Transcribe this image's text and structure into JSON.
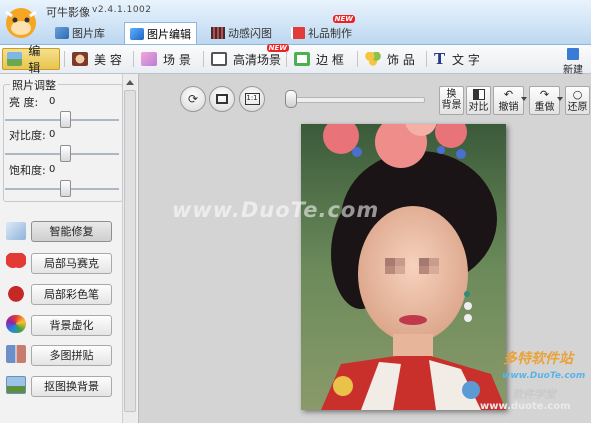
{
  "app": {
    "title": "可牛影像",
    "version": "v2.4.1.1002"
  },
  "main_tabs": [
    {
      "label": "图片库",
      "icon": "gallery-icon",
      "active": false
    },
    {
      "label": "图片编辑",
      "icon": "edit-photo-icon",
      "active": true
    },
    {
      "label": "动感闪图",
      "icon": "film-icon",
      "active": false
    },
    {
      "label": "礼品制作",
      "icon": "gift-icon",
      "active": false,
      "badge": "NEW"
    }
  ],
  "toolbar": {
    "items": [
      {
        "label": "编 辑",
        "icon": "edit-landscape-icon",
        "active": true
      },
      {
        "label": "美 容",
        "icon": "face-icon",
        "active": false
      },
      {
        "label": "场 景",
        "icon": "scene-icon",
        "active": false
      },
      {
        "label": "高清场景",
        "icon": "hd-scene-icon",
        "active": false,
        "badge": "NEW"
      },
      {
        "label": "边 框",
        "icon": "frame-icon",
        "active": false
      },
      {
        "label": "饰 品",
        "icon": "clover-icon",
        "active": false
      },
      {
        "label": "文 字",
        "icon": "text-t-icon",
        "active": false
      }
    ],
    "new_label": "新建"
  },
  "adjust": {
    "title": "照片调整",
    "sliders": [
      {
        "label": "亮  度:",
        "value": "0",
        "level": 0.5
      },
      {
        "label": "对比度:",
        "value": "0",
        "level": 0.5
      },
      {
        "label": "饱和度:",
        "value": "0",
        "level": 0.5
      }
    ]
  },
  "features": [
    {
      "label": "智能修复",
      "icon": "magic-wand-icon",
      "active": true
    },
    {
      "label": "局部马赛克",
      "icon": "heart-mosaic-icon",
      "active": false
    },
    {
      "label": "局部彩色笔",
      "icon": "apple-icon",
      "active": false
    },
    {
      "label": "背景虚化",
      "icon": "color-dots-icon",
      "active": false
    },
    {
      "label": "多图拼贴",
      "icon": "collage-icon",
      "active": false
    },
    {
      "label": "抠图换背景",
      "icon": "cutout-icon",
      "active": false
    }
  ],
  "view_controls": [
    "rotate-icon",
    "fit-screen-icon",
    "actual-size-icon"
  ],
  "zoom_level": 0.02,
  "edit_buttons": [
    {
      "label": "换\n背景",
      "icon": "swap-bg-icon"
    },
    {
      "label": "对比",
      "icon": "compare-icon"
    },
    {
      "label": "撤销",
      "icon": "undo-icon",
      "dropdown": true
    },
    {
      "label": "重做",
      "icon": "redo-icon",
      "dropdown": true
    },
    {
      "label": "还原",
      "icon": "restore-icon"
    }
  ],
  "watermarks": {
    "center": "www.DuoTe.com",
    "site_cn": "多特软件站",
    "site_url": "www.DuoTe.com",
    "corner": "www.duote.com",
    "corner_cn": "软件学堂"
  }
}
